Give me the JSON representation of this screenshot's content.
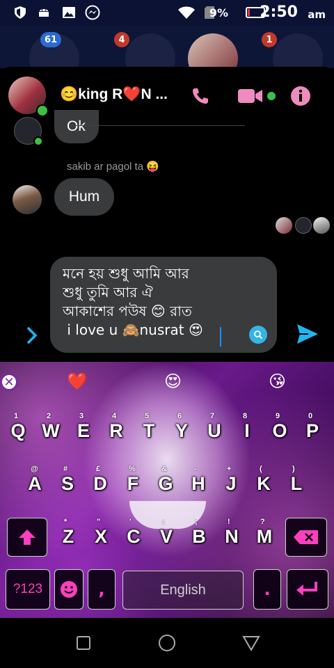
{
  "status_bar": {
    "time": "2:50",
    "ampm": "am",
    "battery_percent": "9%",
    "icons": [
      "shield-icon",
      "android-icon",
      "image-icon",
      "messenger-icon",
      "wifi-icon",
      "sim-icon",
      "battery-icon"
    ]
  },
  "background_bubbles": {
    "badges": [
      "61",
      "4",
      "1"
    ]
  },
  "chat_header": {
    "title": "😊king R❤️N ...",
    "online": true,
    "accent_color": "#f08bc0"
  },
  "messages": [
    {
      "from": "other",
      "text": "Ok"
    },
    {
      "type": "note",
      "text": "sakib ar pagol ta 😝"
    },
    {
      "from": "other",
      "text": "Hum"
    }
  ],
  "composer": {
    "text": "মনে হয় শুধু আমি আর\nশুধু তুমি আর ঐ\nআকাশের পউষ 😊 রাত\n i love u 🙈nusrat 😍",
    "send_color": "#1fb7f2"
  },
  "keyboard": {
    "suggestions": [
      "❤️",
      "😍",
      "😘"
    ],
    "row1": [
      "Q",
      "W",
      "E",
      "R",
      "T",
      "Y",
      "U",
      "I",
      "O",
      "P"
    ],
    "row1_hints": [
      "1",
      "2",
      "3",
      "4",
      "5",
      "6",
      "7",
      "8",
      "9",
      "0"
    ],
    "row2": [
      "A",
      "S",
      "D",
      "F",
      "G",
      "H",
      "J",
      "K",
      "L"
    ],
    "row2_hints": [
      "@",
      "#",
      "£",
      "%",
      "&",
      "-",
      "+",
      "(",
      ")"
    ],
    "row3": [
      "Z",
      "X",
      "C",
      "V",
      "B",
      "N",
      "M"
    ],
    "row3_hints": [
      "*",
      "\"",
      "'",
      ":",
      ";",
      "!",
      "?"
    ],
    "symbols_label": "?123",
    "comma": ",",
    "space_label": "English",
    "period": ".",
    "accent_color": "#ff3fbf"
  },
  "nav_bar": {
    "icons": [
      "recents-icon",
      "home-icon",
      "back-icon"
    ]
  }
}
